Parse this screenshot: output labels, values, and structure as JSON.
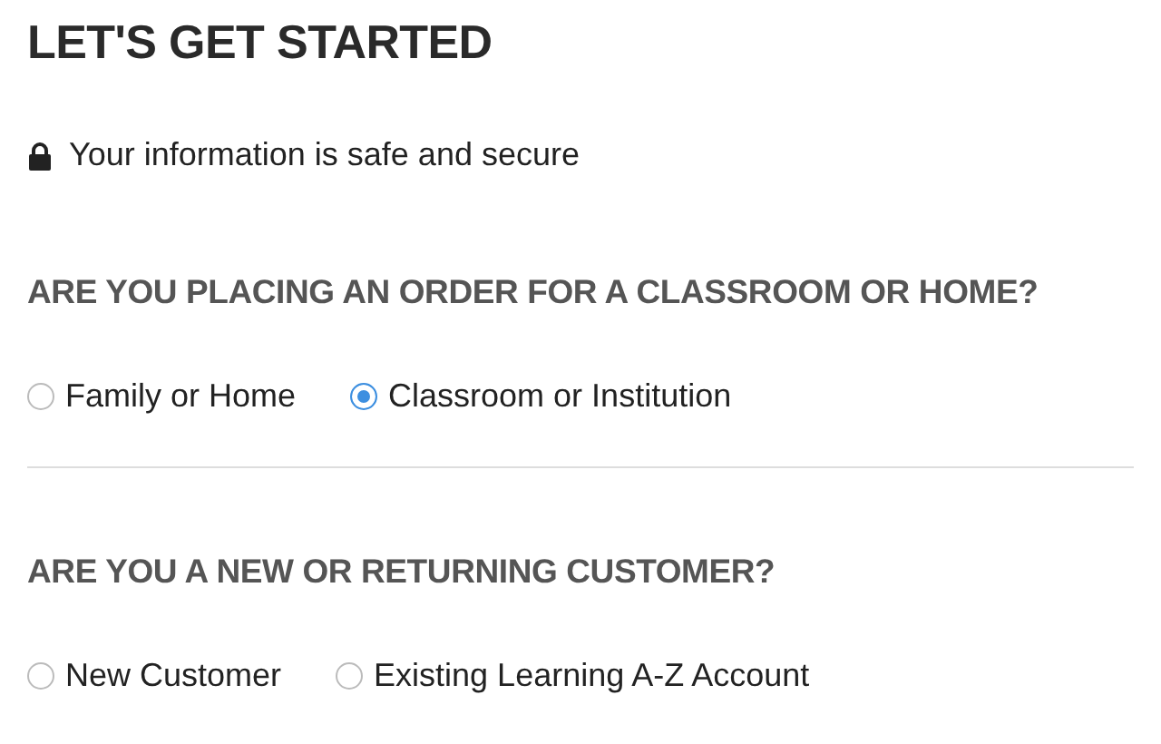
{
  "title": "LET'S GET STARTED",
  "security_note": "Your information is safe and secure",
  "sections": [
    {
      "question": "ARE YOU PLACING AN ORDER FOR A CLASSROOM OR HOME?",
      "options": [
        {
          "label": "Family or Home",
          "selected": false
        },
        {
          "label": "Classroom or Institution",
          "selected": true
        }
      ]
    },
    {
      "question": "ARE YOU A NEW OR RETURNING CUSTOMER?",
      "options": [
        {
          "label": "New Customer",
          "selected": false
        },
        {
          "label": "Existing Learning A-Z Account",
          "selected": false
        }
      ]
    }
  ]
}
